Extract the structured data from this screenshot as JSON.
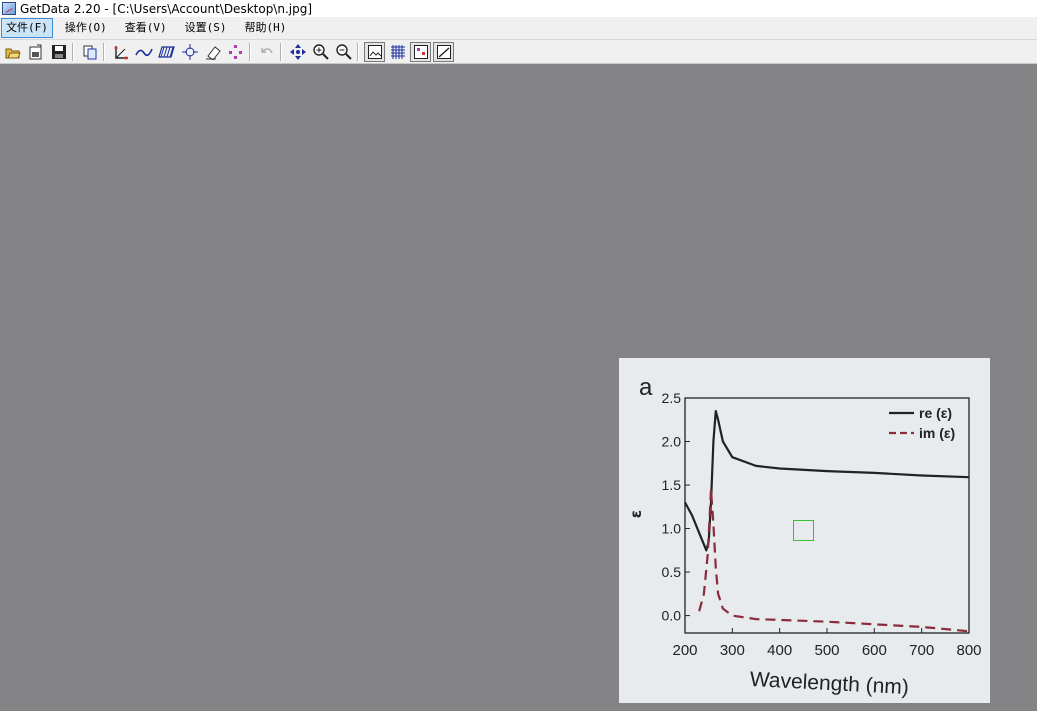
{
  "window": {
    "title": "GetData 2.20 - [C:\\Users\\Account\\Desktop\\n.jpg]"
  },
  "menu": [
    {
      "label": "文件(F)"
    },
    {
      "label": "操作(O)"
    },
    {
      "label": "查看(V)"
    },
    {
      "label": "设置(S)"
    },
    {
      "label": "帮助(H)"
    }
  ],
  "toolbar": {
    "icons": [
      "open-icon",
      "export-icon",
      "save-icon",
      "copy-icon",
      "set-axes-icon",
      "line-digitize-icon",
      "area-digitize-icon",
      "point-capture-icon",
      "eraser-icon",
      "point-order-icon",
      "undo-icon",
      "pan-icon",
      "zoom-in-icon",
      "zoom-out-icon",
      "show-image-icon",
      "show-grid-icon",
      "show-points-icon",
      "show-lines-icon"
    ]
  },
  "colors": {
    "workspace": "#848385",
    "accent_menu": "#cce4f7",
    "series_re": "#222222",
    "series_im": "#8a2c3c",
    "selection": "#38c038"
  },
  "chart_data": {
    "type": "line",
    "panel_label": "a",
    "xlabel": "Wavelength (nm)",
    "ylabel": "ε",
    "xlim": [
      200,
      800
    ],
    "ylim": [
      -0.2,
      2.5
    ],
    "x_ticks": [
      "200",
      "300",
      "400",
      "500",
      "600",
      "700",
      "800"
    ],
    "y_ticks": [
      "0.0",
      "0.5",
      "1.0",
      "1.5",
      "2.0",
      "2.5"
    ],
    "legend_position": "top-right",
    "series": [
      {
        "name": "re (ε)",
        "style": "solid",
        "x": [
          200,
          215,
          230,
          245,
          250,
          255,
          260,
          265,
          270,
          280,
          300,
          350,
          400,
          500,
          600,
          700,
          800
        ],
        "y": [
          1.3,
          1.15,
          0.95,
          0.75,
          0.85,
          1.3,
          2.0,
          2.35,
          2.25,
          2.0,
          1.82,
          1.72,
          1.69,
          1.66,
          1.64,
          1.61,
          1.59
        ]
      },
      {
        "name": "im (ε)",
        "style": "dashed",
        "x": [
          230,
          240,
          248,
          255,
          260,
          265,
          270,
          280,
          300,
          350,
          400,
          500,
          600,
          700,
          800
        ],
        "y": [
          0.05,
          0.25,
          0.7,
          1.45,
          1.05,
          0.55,
          0.25,
          0.08,
          0.0,
          -0.04,
          -0.05,
          -0.07,
          -0.1,
          -0.13,
          -0.18
        ]
      }
    ]
  }
}
